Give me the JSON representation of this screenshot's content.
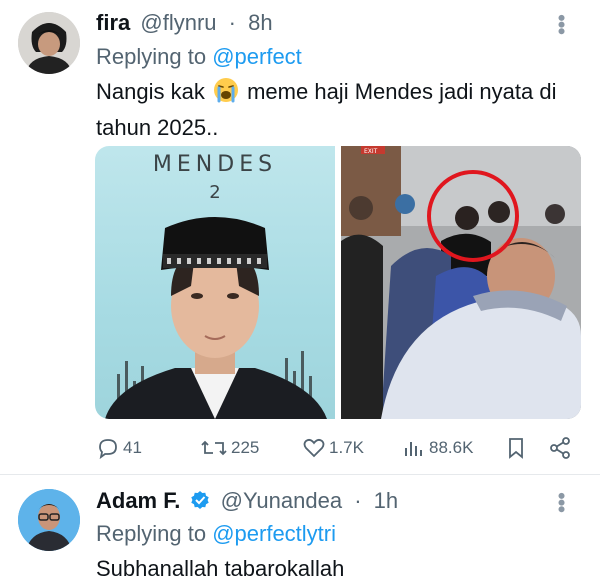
{
  "tweet1": {
    "name": "fira",
    "handle": "@flynru",
    "time": "8h",
    "replying_prefix": "Replying to",
    "replying_to": "@perfect",
    "text_before_emoji": "Nangis kak",
    "emoji": "loudly-crying-face",
    "text_after_emoji": "meme haji Mendes jadi nyata di tahun 2025..",
    "media_left": {
      "title": "MENDES",
      "number": "2"
    },
    "media_right": {
      "sign": "EXIT"
    },
    "actions": {
      "replies": "41",
      "reposts": "225",
      "likes": "1.7K",
      "views": "88.6K"
    }
  },
  "tweet2": {
    "name": "Adam F.",
    "verified": true,
    "handle": "@Yunandea",
    "time": "1h",
    "replying_prefix": "Replying to",
    "replying_to": "@perfectlytri",
    "text": "Subhanallah tabarokallah"
  },
  "colors": {
    "accent": "#1d9bf0",
    "secondary_text": "#536471",
    "primary_text": "#0f1419",
    "highlight_circle": "#e0161e"
  }
}
